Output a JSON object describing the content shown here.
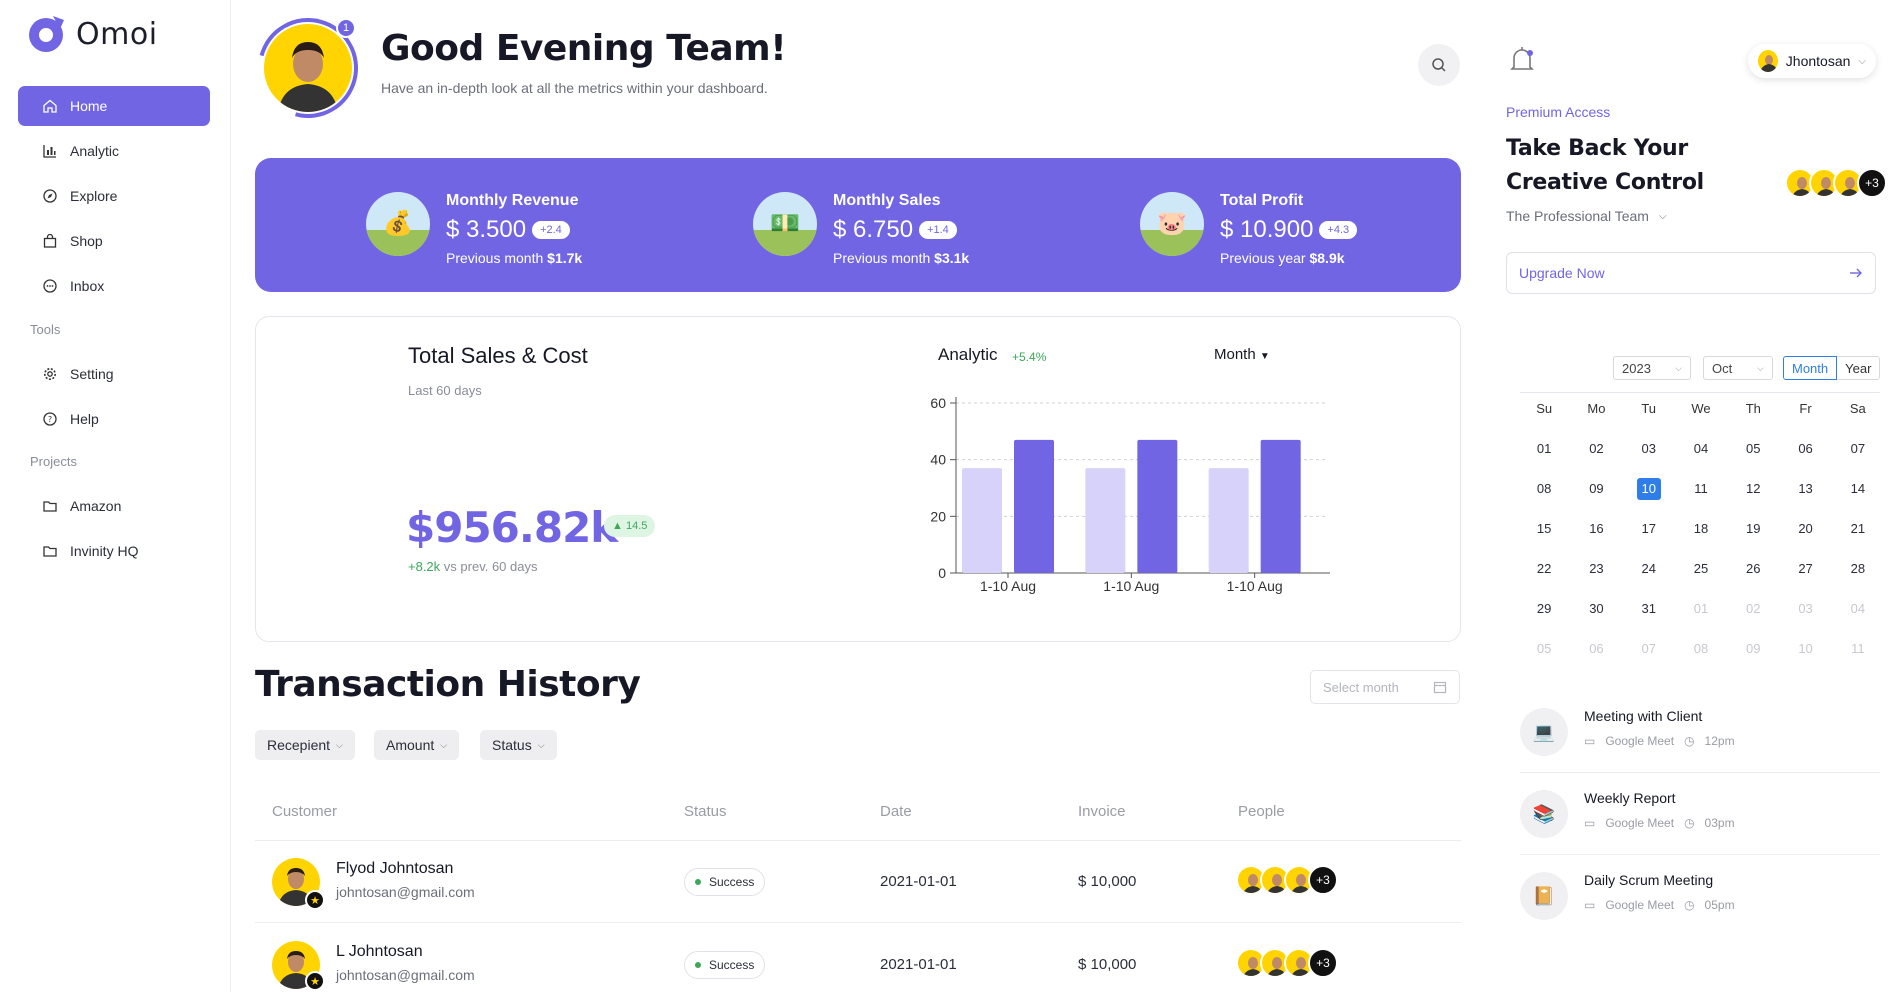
{
  "app": {
    "name": "Omoi"
  },
  "sidebar": {
    "items": [
      {
        "label": "Home",
        "icon": "home-icon"
      },
      {
        "label": "Analytic",
        "icon": "bar-chart-icon"
      },
      {
        "label": "Explore",
        "icon": "compass-icon"
      },
      {
        "label": "Shop",
        "icon": "shopping-bag-icon"
      },
      {
        "label": "Inbox",
        "icon": "chat-icon"
      }
    ],
    "tools_label": "Tools",
    "tools": [
      {
        "label": "Setting",
        "icon": "gear-icon"
      },
      {
        "label": "Help",
        "icon": "help-circle-icon"
      }
    ],
    "projects_label": "Projects",
    "projects": [
      {
        "label": "Amazon",
        "icon": "folder-icon"
      },
      {
        "label": "Invinity HQ",
        "icon": "folder-icon"
      }
    ]
  },
  "header": {
    "notification_count": "1",
    "title": "Good Evening Team!",
    "subtitle": "Have an in-depth look at all the metrics within your dashboard."
  },
  "stats": [
    {
      "title": "Monthly Revenue",
      "value": "$ 3.500",
      "change": "+2.4",
      "prev_label": "Previous month",
      "prev_value": "$1.7k",
      "icon": "money-bag-icon"
    },
    {
      "title": "Monthly Sales",
      "value": "$ 6.750",
      "change": "+1.4",
      "prev_label": "Previous month",
      "prev_value": "$3.1k",
      "icon": "cash-icon"
    },
    {
      "title": "Total Profit",
      "value": "$ 10.900",
      "change": "+4.3",
      "prev_label": "Previous year",
      "prev_value": "$8.9k",
      "icon": "piggy-bank-icon"
    }
  ],
  "sales": {
    "title": "Total Sales & Cost",
    "period": "Last 60 days",
    "total": "$956.82k",
    "change": "14.5",
    "vs_change": "+8.2k",
    "vs_label": "vs prev. 60 days"
  },
  "analytic": {
    "title": "Analytic",
    "change": "+5.4%",
    "period_select": "Month"
  },
  "chart_data": {
    "type": "bar",
    "categories": [
      "1-10 Aug",
      "1-10 Aug",
      "1-10 Aug"
    ],
    "series": [
      {
        "values": [
          37,
          37,
          37
        ],
        "color": "#d6d2fa"
      },
      {
        "values": [
          47,
          47,
          47
        ],
        "color": "#7165e3"
      }
    ],
    "ylim": [
      0,
      60
    ],
    "yticks": [
      0,
      20,
      40,
      60
    ],
    "grid": true
  },
  "transactions": {
    "title": "Transaction History",
    "month_placeholder": "Select month",
    "filters": [
      "Recepient",
      "Amount",
      "Status"
    ],
    "columns": [
      "Customer",
      "Status",
      "Date",
      "Invoice",
      "People"
    ],
    "rows": [
      {
        "name": "Flyod Johntosan",
        "email": "johntosan@gmail.com",
        "status": "Success",
        "date": "2021-01-01",
        "invoice": "$ 10,000",
        "people_more": "+3"
      },
      {
        "name": "L Johntosan",
        "email": "johntosan@gmail.com",
        "status": "Success",
        "date": "2021-01-01",
        "invoice": "$ 10,000",
        "people_more": "+3"
      }
    ]
  },
  "user": {
    "name": "Jhontosan"
  },
  "promo": {
    "badge": "Premium Access",
    "title": "Take Back Your Creative Control",
    "team": "The Professional Team",
    "team_more": "+3",
    "cta": "Upgrade Now"
  },
  "calendar": {
    "year": "2023",
    "month": "Oct",
    "views": [
      "Month",
      "Year"
    ],
    "weekdays": [
      "Su",
      "Mo",
      "Tu",
      "We",
      "Th",
      "Fr",
      "Sa"
    ],
    "days": [
      "01",
      "02",
      "03",
      "04",
      "05",
      "06",
      "07",
      "08",
      "09",
      "10",
      "11",
      "12",
      "13",
      "14",
      "15",
      "16",
      "17",
      "18",
      "19",
      "20",
      "21",
      "22",
      "23",
      "24",
      "25",
      "26",
      "27",
      "28",
      "29",
      "30",
      "31"
    ],
    "trailing_days": [
      "01",
      "02",
      "03",
      "04",
      "05",
      "06",
      "07",
      "08",
      "09",
      "10",
      "11"
    ],
    "selected": "10"
  },
  "events": [
    {
      "title": "Meeting with Client",
      "platform": "Google Meet",
      "time": "12pm",
      "icon": "laptop-icon"
    },
    {
      "title": "Weekly Report",
      "platform": "Google Meet",
      "time": "03pm",
      "icon": "books-icon"
    },
    {
      "title": "Daily Scrum Meeting",
      "platform": "Google Meet",
      "time": "05pm",
      "icon": "notebook-icon"
    }
  ],
  "colors": {
    "accent": "#7165e3",
    "success": "#3ba85a",
    "calendar_selected": "#2f7ee8",
    "avatar_bg": "#ffd400"
  }
}
